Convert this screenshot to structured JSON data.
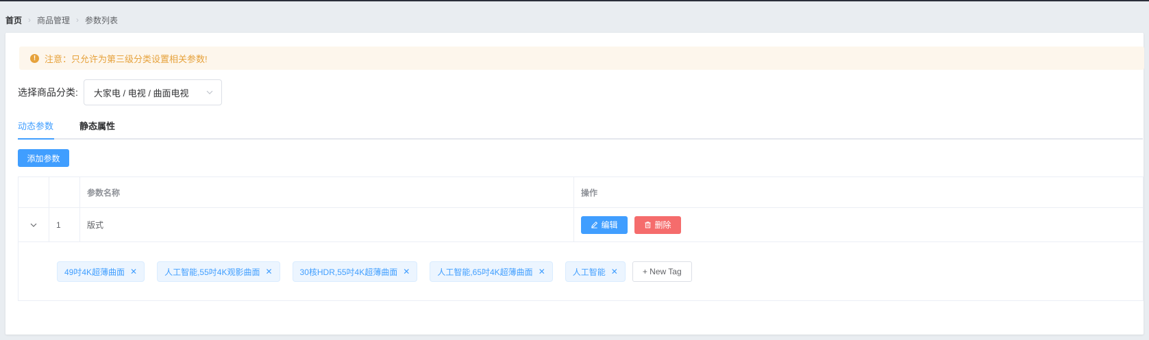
{
  "breadcrumb": {
    "items": [
      "首页",
      "商品管理",
      "参数列表"
    ]
  },
  "alert": {
    "text": "注意：只允许为第三级分类设置相关参数!",
    "icon": "warning-circle-icon",
    "color": "#e6a23c"
  },
  "category_select": {
    "label": "选择商品分类:",
    "value": "大家电 / 电视 / 曲面电视"
  },
  "tabs": [
    {
      "label": "动态参数",
      "active": true
    },
    {
      "label": "静态属性",
      "active": false
    }
  ],
  "toolbar": {
    "add_label": "添加参数"
  },
  "table": {
    "columns": [
      "",
      "",
      "参数名称",
      "操作"
    ],
    "rows": [
      {
        "index": "1",
        "name": "版式",
        "expanded": true
      }
    ],
    "actions": {
      "edit_label": "编辑",
      "delete_label": "删除"
    },
    "tags": [
      "49吋4K超薄曲面",
      "人工智能,55吋4K观影曲面",
      "30核HDR,55吋4K超薄曲面",
      "人工智能,65吋4K超薄曲面",
      "人工智能"
    ],
    "new_tag_label": "+ New Tag"
  },
  "colors": {
    "primary": "#409eff",
    "danger": "#f56c6c",
    "warning": "#e6a23c"
  }
}
